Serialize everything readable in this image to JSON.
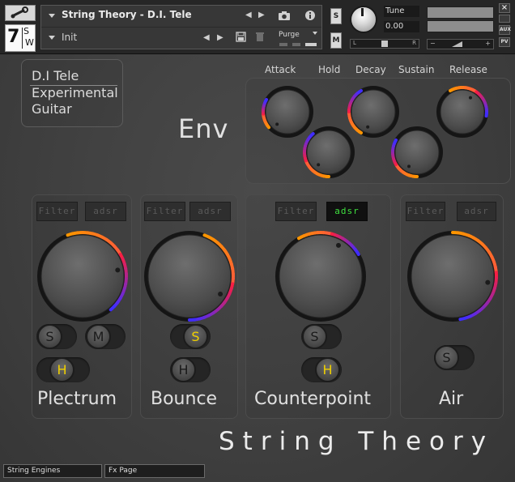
{
  "header": {
    "instrument_name": "String Theory - D.I. Tele",
    "snapshot_name": "Init",
    "purge_label": "Purge",
    "solo_label": "S",
    "mute_label": "M",
    "tune_label": "Tune",
    "tune_value": "0.00",
    "pan_left": "L",
    "pan_right": "R",
    "vol_minus": "−",
    "vol_plus": "+",
    "close_label": "×",
    "aux_label": "AUX",
    "pv_label": "PV",
    "logo_seven": "7",
    "logo_s": "S",
    "logo_w": "W"
  },
  "preset_box": {
    "lines": [
      "D.I Tele",
      "Experimental",
      "Guitar"
    ]
  },
  "env": {
    "title": "Env",
    "labels": {
      "attack": "Attack",
      "hold": "Hold",
      "decay": "Decay",
      "sustain": "Sustain",
      "release": "Release"
    }
  },
  "engines": [
    {
      "name": "Plectrum",
      "filter_label": "Filter",
      "adsr_label": "adsr",
      "adsr_active": false,
      "buttons": [
        "S",
        "M",
        "H"
      ]
    },
    {
      "name": "Bounce",
      "filter_label": "Filter",
      "adsr_label": "adsr",
      "adsr_active": false,
      "buttons": [
        "S",
        "H"
      ]
    },
    {
      "name": "Counterpoint",
      "filter_label": "Filter",
      "adsr_label": "adsr",
      "adsr_active": true,
      "buttons": [
        "S",
        "H"
      ]
    },
    {
      "name": "Air",
      "filter_label": "Filter",
      "adsr_label": "adsr",
      "adsr_active": false,
      "buttons": [
        "S"
      ]
    }
  ],
  "product_title": "String Theory",
  "footer": {
    "tabs": [
      "String Engines",
      "Fx Page"
    ]
  },
  "colors": {
    "background": "#444444",
    "panel_dark": "#262626",
    "text": "#e0e0e0",
    "adsr_active": "#3fe03f",
    "button_lit": "#f0d000",
    "knob_ring_blue": "#3c3cff",
    "knob_ring_orange": "#ff9a00"
  }
}
